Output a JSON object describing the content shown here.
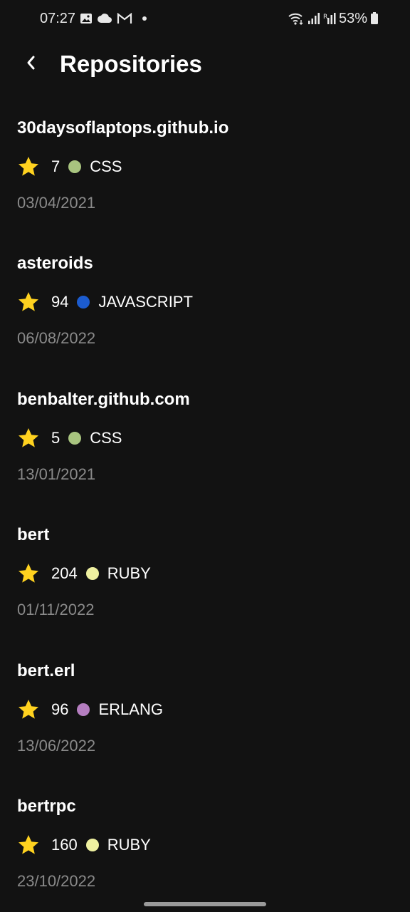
{
  "status_bar": {
    "time": "07:27",
    "battery": "53%",
    "icons_left": [
      "gallery-icon",
      "cloud-icon",
      "gmail-icon",
      "notification-dot"
    ],
    "icons_right": [
      "wifi-icon",
      "signal-icon",
      "signal-r-icon",
      "battery-icon"
    ]
  },
  "app_bar": {
    "back_icon": "chevron-left-icon",
    "title": "Repositories"
  },
  "colors": {
    "background": "#121212",
    "star": "#FFD21F",
    "date": "#8a8a8a",
    "CSS": "#A8C47F",
    "JAVASCRIPT": "#1C5CCF",
    "RUBY": "#EEF0A0",
    "ERLANG": "#B57EC0"
  },
  "repos": [
    {
      "name": "30daysoflaptops.github.io",
      "stars": "7",
      "language": "CSS",
      "lang_color": "#A8C47F",
      "date": "03/04/2021"
    },
    {
      "name": "asteroids",
      "stars": "94",
      "language": "JAVASCRIPT",
      "lang_color": "#1C5CCF",
      "date": "06/08/2022"
    },
    {
      "name": "benbalter.github.com",
      "stars": "5",
      "language": "CSS",
      "lang_color": "#A8C47F",
      "date": "13/01/2021"
    },
    {
      "name": "bert",
      "stars": "204",
      "language": "RUBY",
      "lang_color": "#EEF0A0",
      "date": "01/11/2022"
    },
    {
      "name": "bert.erl",
      "stars": "96",
      "language": "ERLANG",
      "lang_color": "#B57EC0",
      "date": "13/06/2022"
    },
    {
      "name": "bertrpc",
      "stars": "160",
      "language": "RUBY",
      "lang_color": "#EEF0A0",
      "date": "23/10/2022"
    }
  ]
}
